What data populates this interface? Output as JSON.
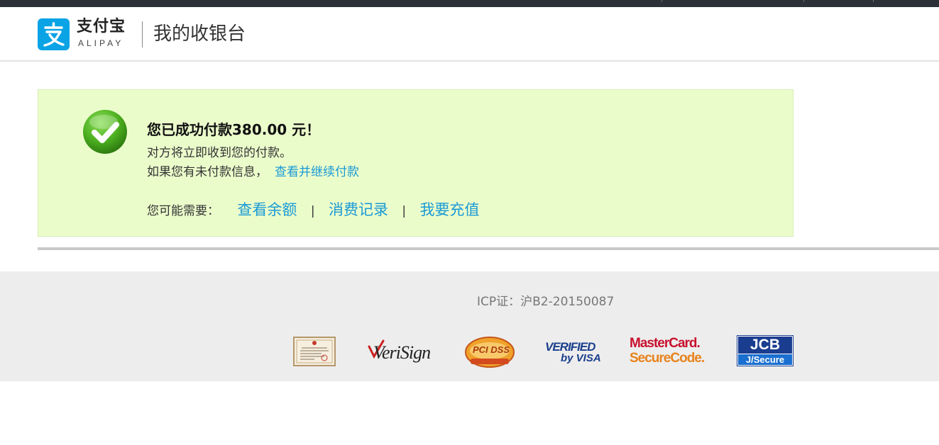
{
  "header": {
    "logo_cn": "支付宝",
    "logo_en": "ALIPAY",
    "title": "我的收银台"
  },
  "result": {
    "title": "您已成功付款380.00 元！",
    "line1": "对方将立即收到您的付款。",
    "line2_text": "如果您有未付款信息，",
    "line2_link": "查看并继续付款",
    "need_label": "您可能需要：",
    "links": [
      "查看余额",
      "消费记录",
      "我要充值"
    ],
    "separator": "|"
  },
  "footer": {
    "icp": "ICP证：沪B2-20150087",
    "badges": {
      "verisign": "VeriSign",
      "pcidss": "PCI DSS",
      "visa_line1": "VERIFIED",
      "visa_line2": "by VISA",
      "mastercard_line1": "MasterCard.",
      "mastercard_line2": "SecureCode.",
      "jcb_line1": "JCB",
      "jcb_line2": "J/Secure"
    }
  },
  "colors": {
    "brand": "#0aa3e5",
    "link": "#1a9ad6",
    "success_bg": "#ebfccb",
    "success_icon": "#4caf1f"
  }
}
